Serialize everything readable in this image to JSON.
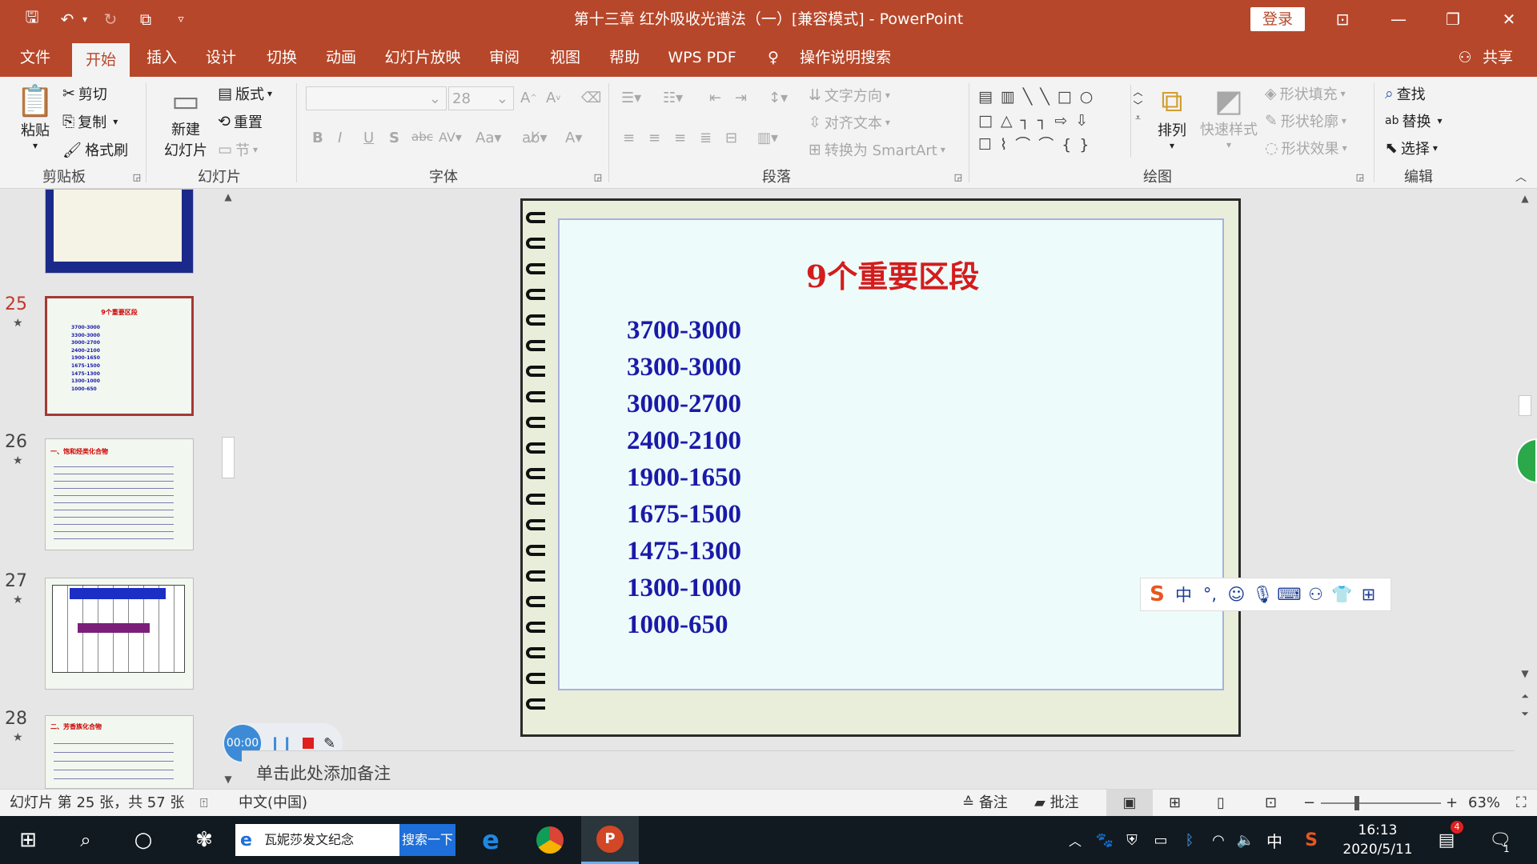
{
  "window": {
    "title": "第十三章 红外吸收光谱法（一）[兼容模式] - PowerPoint",
    "login_label": "登录"
  },
  "menu": {
    "tabs": [
      "文件",
      "开始",
      "插入",
      "设计",
      "切换",
      "动画",
      "幻灯片放映",
      "审阅",
      "视图",
      "帮助",
      "WPS PDF"
    ],
    "tell_me": "操作说明搜索",
    "share": "共享"
  },
  "ribbon": {
    "clipboard": {
      "paste": "粘贴",
      "cut": "剪切",
      "copy": "复制",
      "format_painter": "格式刷",
      "label": "剪贴板"
    },
    "slides": {
      "new_slide_1": "新建",
      "new_slide_2": "幻灯片",
      "layout": "版式",
      "reset": "重置",
      "section": "节",
      "label": "幻灯片"
    },
    "font": {
      "size": "28",
      "label": "字体"
    },
    "paragraph": {
      "text_direction": "文字方向",
      "align_text": "对齐文本",
      "smartart": "转换为 SmartArt",
      "label": "段落"
    },
    "drawing": {
      "arrange": "排列",
      "quick_styles": "快速样式",
      "shape_fill": "形状填充",
      "shape_outline": "形状轮廓",
      "shape_effects": "形状效果",
      "label": "绘图"
    },
    "editing": {
      "find": "查找",
      "replace": "替换",
      "select": "选择",
      "label": "编辑"
    }
  },
  "thumbnails": [
    {
      "num": "25",
      "title": "9个重要区段"
    },
    {
      "num": "26",
      "title": "一、饱和烃类化合物"
    },
    {
      "num": "27",
      "title": ""
    },
    {
      "num": "28",
      "title": "二、芳香族化合物"
    }
  ],
  "slide": {
    "title": "9个重要区段",
    "ranges": [
      "3700-3000",
      "3300-3000",
      "3000-2700",
      "2400-2100",
      "1900-1650",
      "1675-1500",
      "1475-1300",
      "1300-1000",
      "1000-650"
    ]
  },
  "ime": {
    "mode": "中",
    "punct": "°,"
  },
  "recorder": {
    "time": "00:00"
  },
  "notes": {
    "placeholder": "单击此处添加备注"
  },
  "status": {
    "slide_info": "幻灯片 第 25 张，共 57 张",
    "language": "中文(中国)",
    "notes_btn": "备注",
    "comments_btn": "批注",
    "zoom": "63%"
  },
  "taskbar": {
    "search_text": "瓦妮莎发文纪念",
    "search_btn": "搜索一下",
    "ime": "中",
    "time": "16:13",
    "date": "2020/5/11",
    "notif_count": "4",
    "action_count": "1"
  },
  "colors": {
    "accent": "#b7472a",
    "slide_title": "#d41c1c",
    "slide_text": "#1a1aa8"
  }
}
